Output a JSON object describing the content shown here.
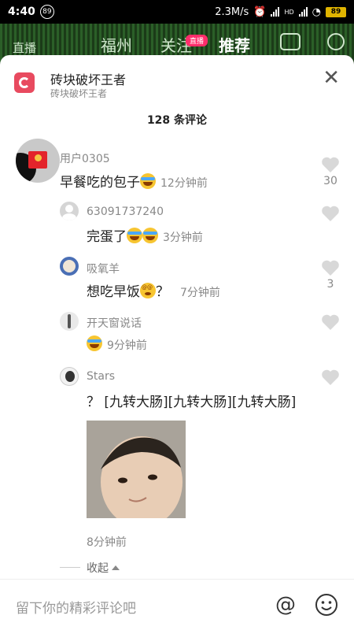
{
  "status": {
    "time": "4:40",
    "badge": "89",
    "speed": "2.3M/s",
    "network": "HD",
    "battery": "89"
  },
  "bg_nav": {
    "live": "直播",
    "city": "福州",
    "follow": "关注",
    "live_tag": "直播",
    "recommend": "推荐"
  },
  "header": {
    "title": "砖块破坏王者",
    "subtitle": "砖块破坏王者",
    "comment_count": "128 条评论"
  },
  "comments": [
    {
      "user": "用户0305",
      "text": "早餐吃的包子",
      "emoji": [
        "laugh-cry"
      ],
      "time": "12分钟前",
      "likes": "30"
    },
    {
      "user": "63091737240",
      "text": "完蛋了",
      "emoji": [
        "laugh-cry",
        "laugh-cry"
      ],
      "time": "3分钟前",
      "likes": ""
    },
    {
      "user": "吸氧羊",
      "text": "想吃早饭",
      "emoji": [
        "dizzy"
      ],
      "suffix": "？",
      "time": "7分钟前",
      "likes": "3"
    },
    {
      "user": "开天窗说话",
      "text": "",
      "emoji": [
        "laugh-cry"
      ],
      "time": "9分钟前",
      "likes": ""
    },
    {
      "user": "Stars",
      "text": "？ [九转大肠][九转大肠][九转大肠]",
      "time": "8分钟前",
      "likes": "",
      "has_image": true
    }
  ],
  "fold": {
    "label": "收起"
  },
  "input": {
    "placeholder": "留下你的精彩评论吧"
  },
  "colors": {
    "brand": "#e84a5f",
    "accent": "#ff2d6b",
    "heart": "#d8d8d8"
  }
}
